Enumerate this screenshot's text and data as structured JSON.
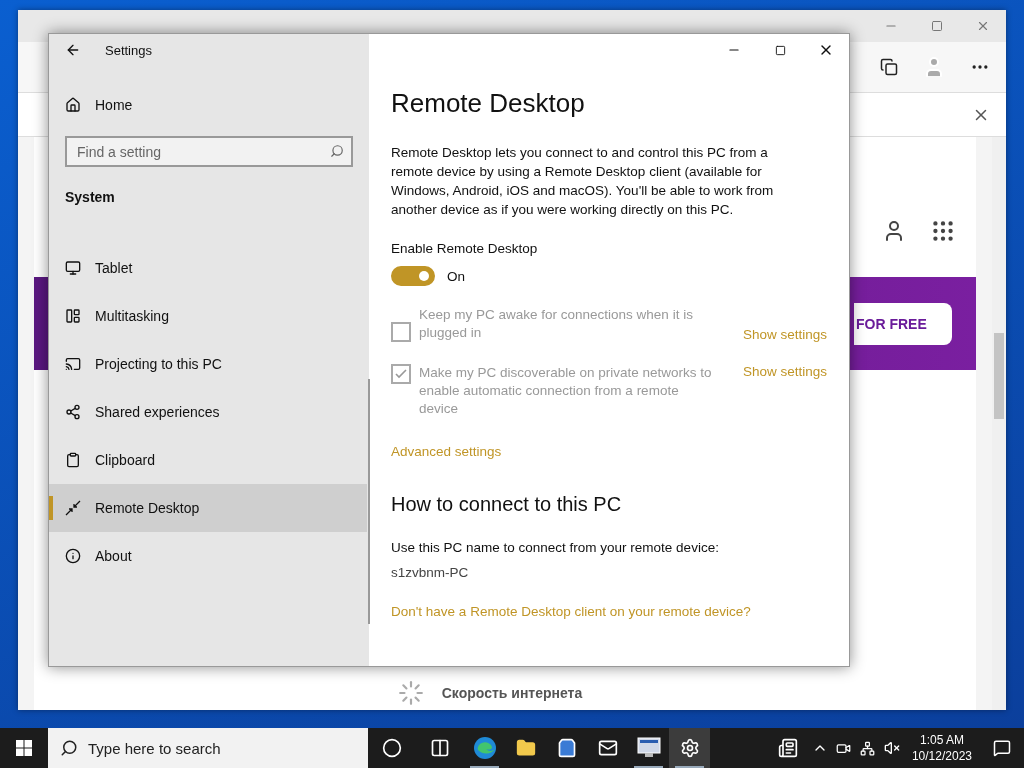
{
  "browser": {
    "banner_button": "FOR FREE",
    "footer_text": "Скорость интернета"
  },
  "settings": {
    "title": "Settings",
    "home": "Home",
    "search": {
      "placeholder": "Find a setting"
    },
    "section": "System",
    "nav": [
      {
        "kind": "tablet",
        "label": "Tablet",
        "selected": false
      },
      {
        "kind": "multitasking",
        "label": "Multitasking",
        "selected": false
      },
      {
        "kind": "projecting",
        "label": "Projecting to this PC",
        "selected": false
      },
      {
        "kind": "shared",
        "label": "Shared experiences",
        "selected": false
      },
      {
        "kind": "clipboard",
        "label": "Clipboard",
        "selected": false
      },
      {
        "kind": "remote",
        "label": "Remote Desktop",
        "selected": true
      },
      {
        "kind": "about",
        "label": "About",
        "selected": false
      }
    ],
    "page": {
      "title": "Remote Desktop",
      "description": "Remote Desktop lets you connect to and control this PC from a remote device by using a Remote Desktop client (available for Windows, Android, iOS and macOS). You'll be able to work from another device as if you were working directly on this PC.",
      "toggle": {
        "label": "Enable Remote Desktop",
        "on": true,
        "state_text": "On"
      },
      "options": [
        {
          "label": "Keep my PC awake for connections when it is plugged in",
          "checked": false,
          "disabled": true,
          "link": "Show settings"
        },
        {
          "label": "Make my PC discoverable on private networks to enable automatic connection from a remote device",
          "checked": true,
          "disabled": true,
          "link": "Show settings"
        }
      ],
      "advanced_link": "Advanced settings",
      "connect_heading": "How to connect to this PC",
      "connect_text": "Use this PC name to connect from your remote device:",
      "pc_name": "s1zvbnm-PC",
      "client_link": "Don't have a Remote Desktop client on your remote device?"
    }
  },
  "taskbar": {
    "search_placeholder": "Type here to search",
    "apps": [
      {
        "kind": "cortana",
        "running": false,
        "active": false
      },
      {
        "kind": "taskview",
        "running": false,
        "active": false
      },
      {
        "kind": "edge",
        "running": true,
        "active": false
      },
      {
        "kind": "explorer",
        "running": false,
        "active": false
      },
      {
        "kind": "store",
        "running": false,
        "active": false
      },
      {
        "kind": "mail",
        "running": false,
        "active": false
      },
      {
        "kind": "network",
        "running": true,
        "active": false
      },
      {
        "kind": "settings",
        "running": true,
        "active": true
      }
    ],
    "time": "1:05 AM",
    "date": "10/12/2023"
  }
}
